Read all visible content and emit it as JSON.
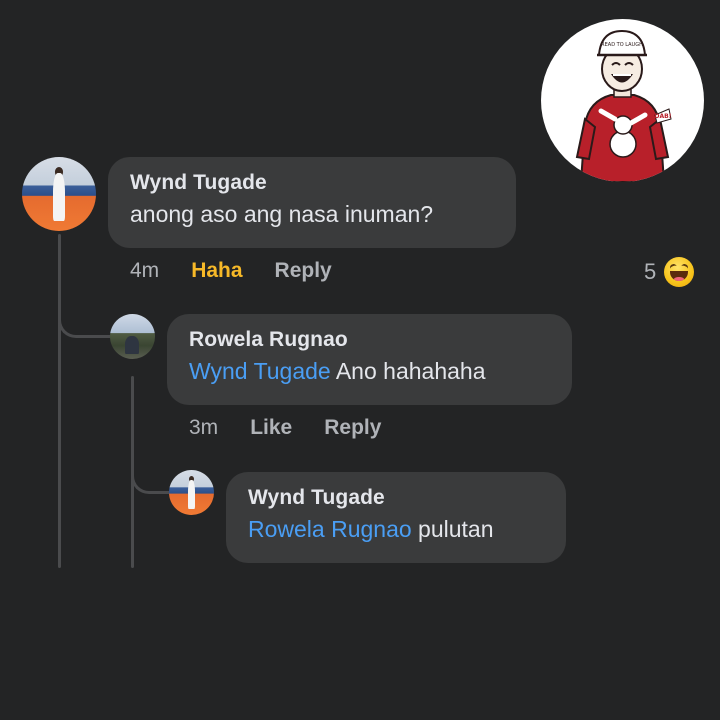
{
  "sticker": {
    "cap_text": "READ TO LAUGH",
    "sweater_text": "DAB!"
  },
  "comment": {
    "author": "Wynd Tugade",
    "text": "anong aso ang nasa inuman?",
    "time": "4m",
    "reaction_label": "Haha",
    "reply_label": "Reply",
    "reaction_count": "5",
    "reaction_icon": "haha-emoji-icon"
  },
  "reply1": {
    "author": "Rowela Rugnao",
    "mention": "Wynd Tugade",
    "text": " Ano hahahaha",
    "time": "3m",
    "like_label": "Like",
    "reply_label": "Reply"
  },
  "reply2": {
    "author": "Wynd Tugade",
    "mention": "Rowela Rugnao",
    "text": " pulutan"
  },
  "colors": {
    "background": "#242526",
    "bubble": "#3a3b3c",
    "mention": "#4a9ef4",
    "haha": "#f7b928",
    "muted": "#b0b3b8"
  }
}
